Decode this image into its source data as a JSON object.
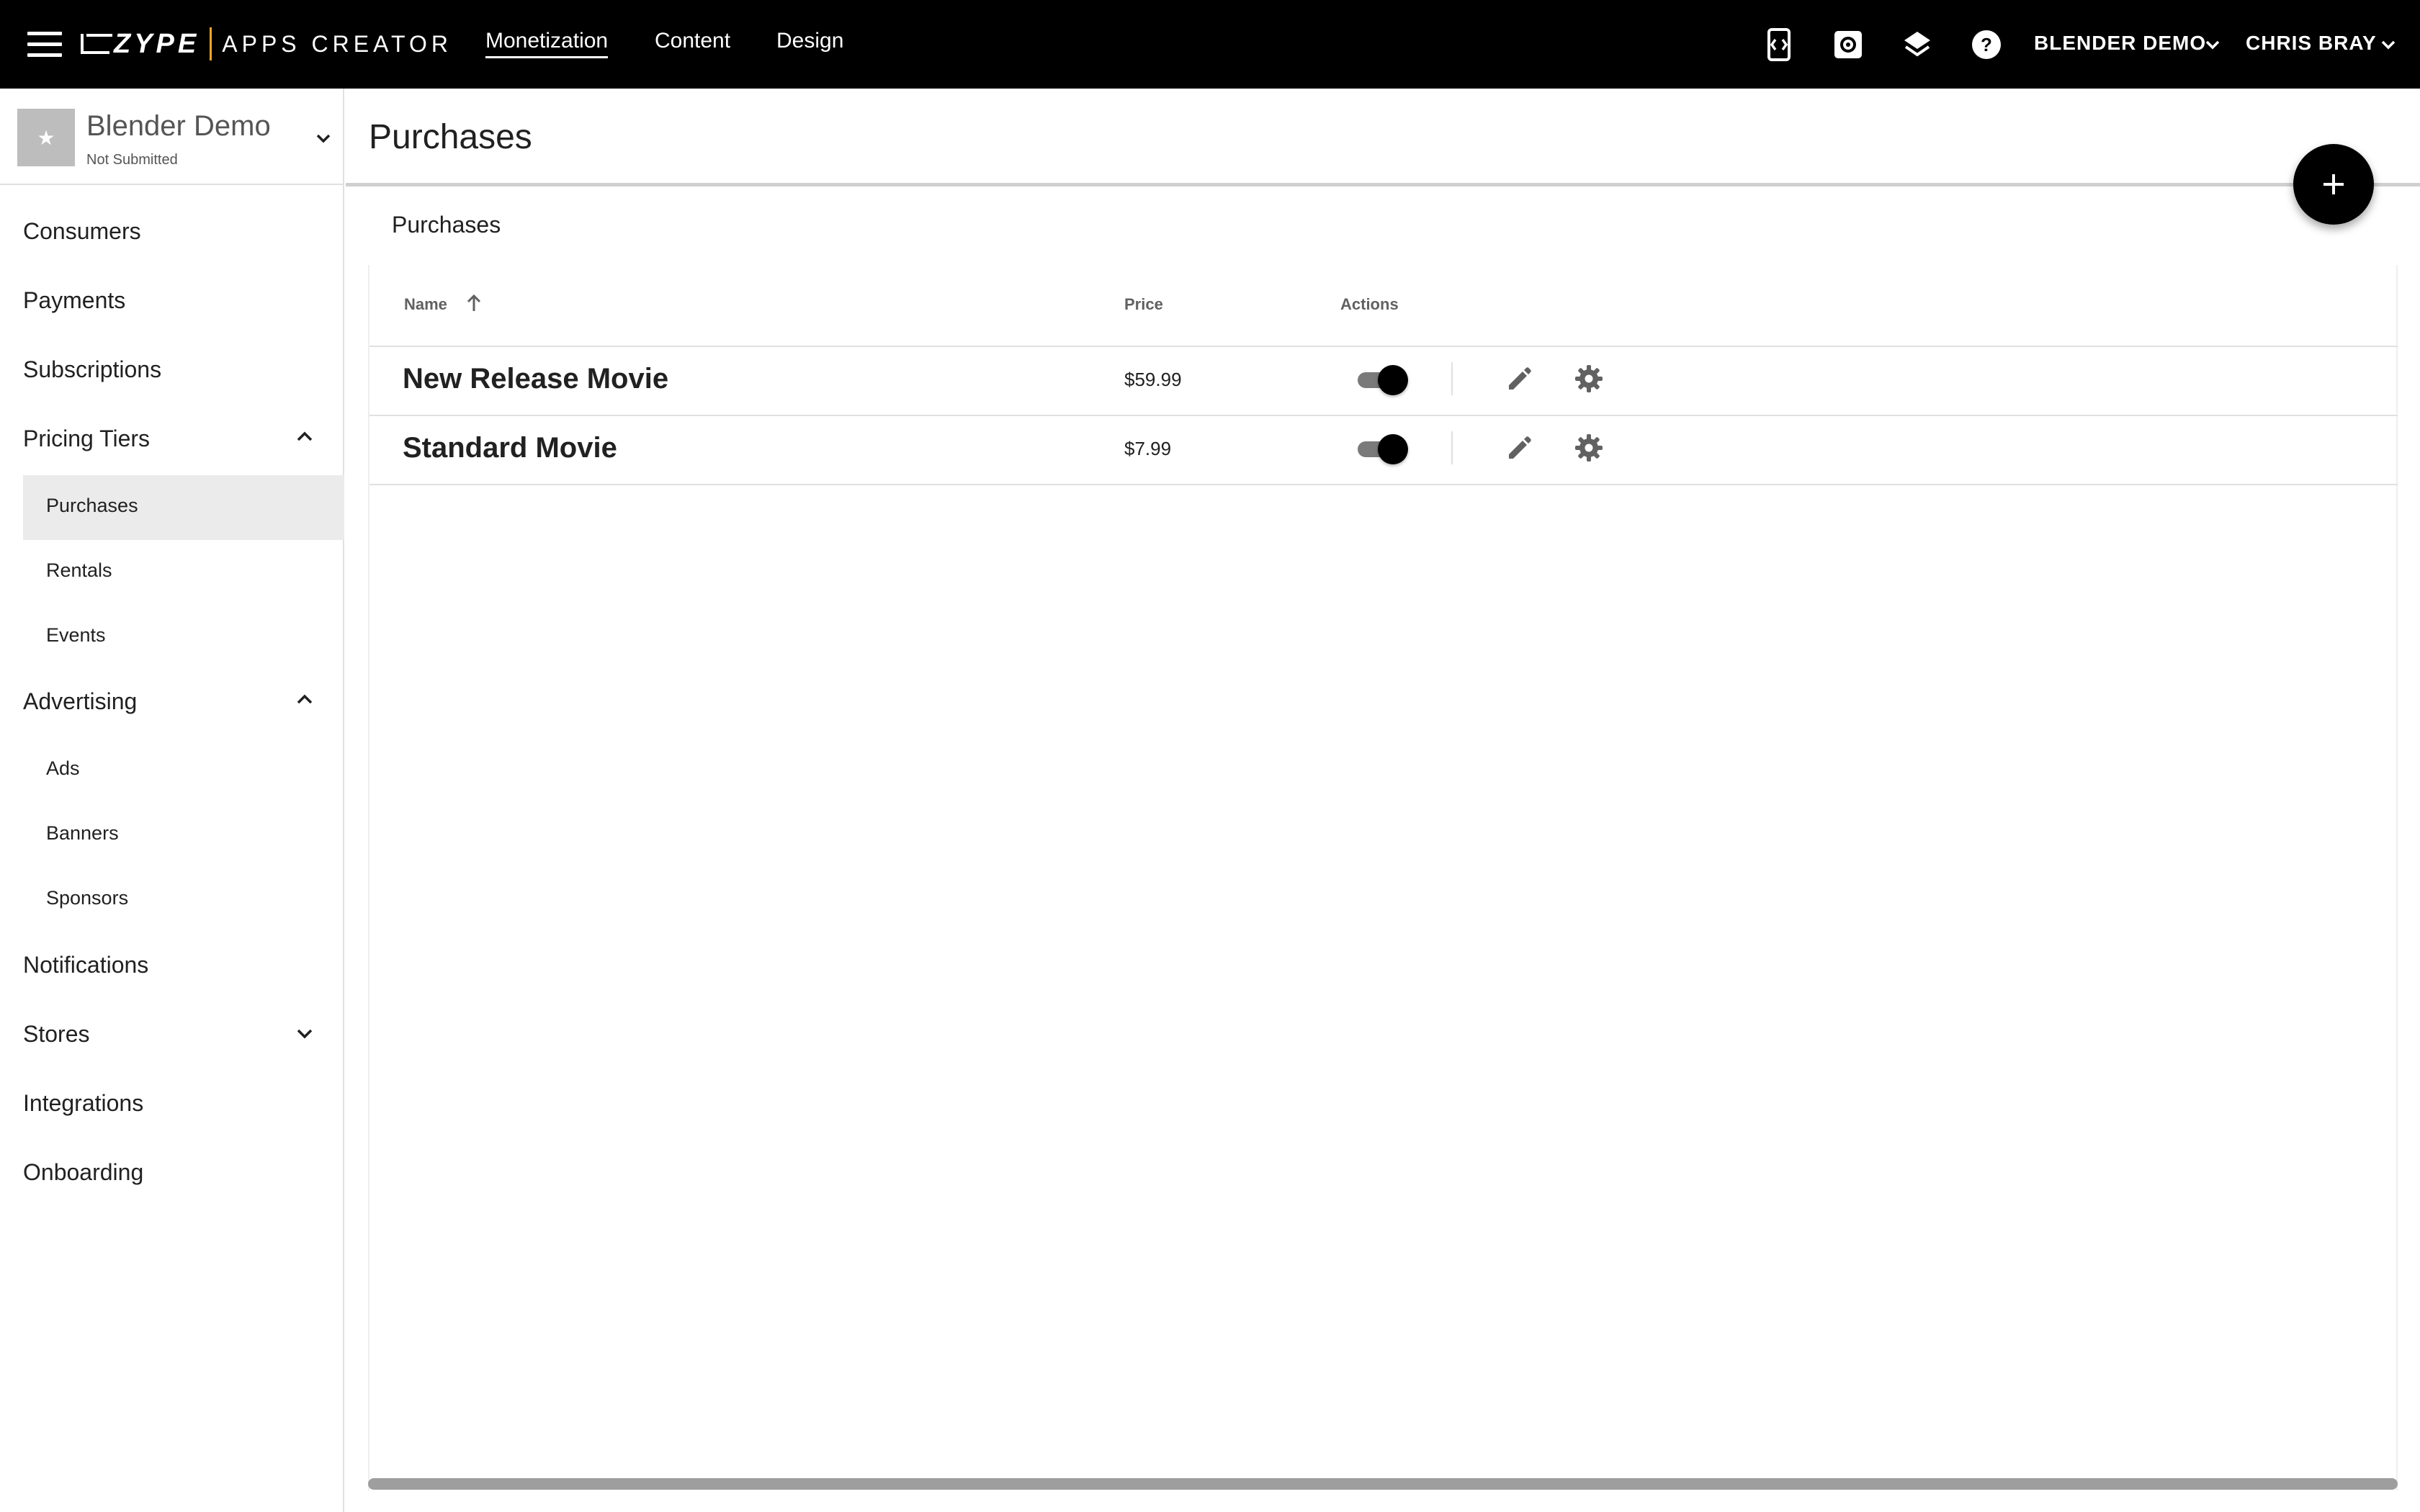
{
  "topbar": {
    "brand": "ZYPE",
    "product": "APPS CREATOR",
    "tabs": [
      {
        "label": "Monetization",
        "active": true
      },
      {
        "label": "Content",
        "active": false
      },
      {
        "label": "Design",
        "active": false
      }
    ],
    "app_switcher": "BLENDER DEMO",
    "user_menu": "CHRIS BRAY",
    "icons": [
      "menu-icon",
      "mobile-preview-icon",
      "settings-icon",
      "layers-icon",
      "help-icon"
    ]
  },
  "sidebar": {
    "app": {
      "name": "Blender Demo",
      "status": "Not Submitted"
    },
    "items": {
      "consumers": "Consumers",
      "payments": "Payments",
      "subscriptions": "Subscriptions",
      "pricing_tiers": "Pricing Tiers",
      "purchases": "Purchases",
      "rentals": "Rentals",
      "events": "Events",
      "advertising": "Advertising",
      "ads": "Ads",
      "banners": "Banners",
      "sponsors": "Sponsors",
      "notifications": "Notifications",
      "stores": "Stores",
      "integrations": "Integrations",
      "onboarding": "Onboarding"
    },
    "active_item": "Purchases"
  },
  "main": {
    "title": "Purchases",
    "section_label": "Purchases",
    "table": {
      "headers": {
        "name": "Name",
        "price": "Price",
        "actions": "Actions"
      },
      "sort": {
        "column": "Name",
        "direction": "ascending"
      },
      "rows": [
        {
          "name": "New Release Movie",
          "price": "$59.99",
          "enabled": true
        },
        {
          "name": "Standard Movie",
          "price": "$7.99",
          "enabled": true
        }
      ]
    }
  },
  "colors": {
    "topbar_bg": "#000000",
    "accent": "#f5a623",
    "active_bg": "#ebebeb"
  }
}
